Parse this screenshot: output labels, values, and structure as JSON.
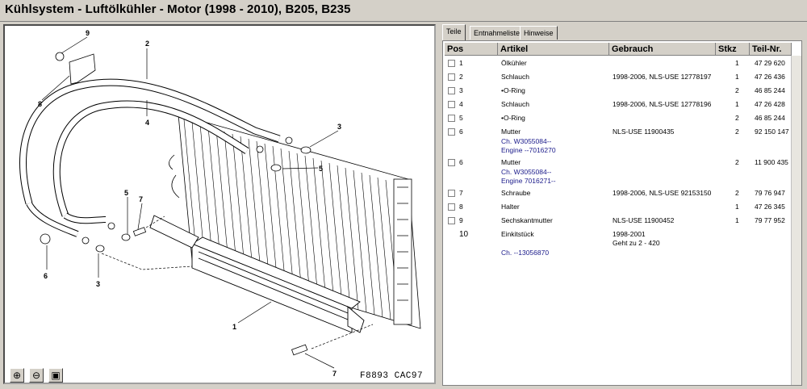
{
  "window_title": "Kühlsystem - Luftölkühler - Motor   (1998 - 2010), B205, B235",
  "tabs": [
    "Teile",
    "Entnahmeliste",
    "Hinweise"
  ],
  "columns": [
    "Pos",
    "Artikel",
    "Gebrauch",
    "Stkz",
    "Teil-Nr."
  ],
  "rows": [
    {
      "pos": "1",
      "artikel": "Ölkühler",
      "gebrauch": "",
      "stkz": "1",
      "teil": "47 29 620"
    },
    {
      "pos": "2",
      "artikel": "Schlauch",
      "gebrauch": "1998-2006, NLS-USE 12778197",
      "stkz": "1",
      "teil": "47 26 436"
    },
    {
      "pos": "3",
      "artikel": "•O-Ring",
      "gebrauch": "",
      "stkz": "2",
      "teil": "46 85 244"
    },
    {
      "pos": "4",
      "artikel": "Schlauch",
      "gebrauch": "1998-2006, NLS-USE 12778196",
      "stkz": "1",
      "teil": "47 26 428"
    },
    {
      "pos": "5",
      "artikel": "•O-Ring",
      "gebrauch": "",
      "stkz": "2",
      "teil": "46 85 244"
    },
    {
      "pos": "6",
      "artikel": "Mutter",
      "note1": "Ch. W3055084--",
      "note2": "Engine --7016270",
      "gebrauch": "NLS-USE 11900435",
      "stkz": "2",
      "teil": "92 150 147"
    },
    {
      "pos": "6",
      "artikel": "Mutter",
      "note1": "Ch. W3055084--",
      "note2": "Engine 7016271--",
      "gebrauch": "",
      "stkz": "2",
      "teil": "11 900 435"
    },
    {
      "pos": "7",
      "artikel": "Schraube",
      "gebrauch": "1998-2006, NLS-USE 92153150",
      "stkz": "2",
      "teil": "79 76 947"
    },
    {
      "pos": "8",
      "artikel": "Halter",
      "gebrauch": "",
      "stkz": "1",
      "teil": "47 26 345"
    },
    {
      "pos": "9",
      "artikel": "Sechskantmutter",
      "gebrauch": "NLS-USE 11900452",
      "stkz": "1",
      "teil": "79 77 952"
    },
    {
      "pos": "10",
      "artikel": "Einkitstück",
      "note1": "Ch. --13056870",
      "gebrauch": "1998-2001",
      "gebrauch2": "Geht zu 2 - 420",
      "stkz": "",
      "teil": ""
    }
  ],
  "diagram_code": "F8893 CAC97",
  "callouts": [
    "1",
    "2",
    "3",
    "3",
    "4",
    "5",
    "5",
    "6",
    "7",
    "7",
    "8",
    "9"
  ],
  "icons": [
    "zoom-in-icon",
    "zoom-out-icon",
    "fit-window-icon"
  ]
}
